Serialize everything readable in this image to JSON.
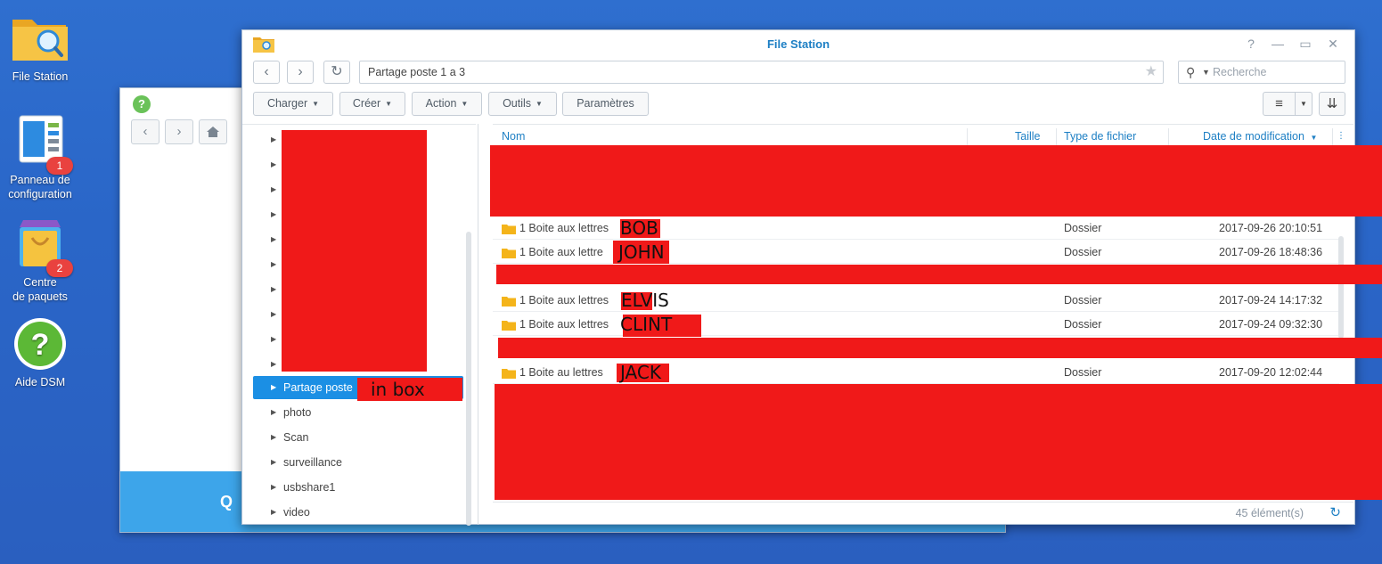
{
  "desktop": {
    "icons": [
      {
        "label": "File Station"
      },
      {
        "label": "Panneau de\nconfiguration",
        "badge": "1"
      },
      {
        "label": "Centre\nde paquets",
        "badge": "2"
      },
      {
        "label": "Aide DSM"
      }
    ]
  },
  "background_window": {
    "help_glyph": "?",
    "bottom_glyph": "Q"
  },
  "window": {
    "title": "File Station",
    "controls": {
      "help": "?",
      "minimize": "—",
      "maximize": "▭",
      "close": "✕"
    },
    "path": "Partage poste 1 a 3",
    "search_placeholder": "Recherche",
    "toolbar": {
      "upload": "Charger",
      "create": "Créer",
      "action": "Action",
      "tools": "Outils",
      "settings": "Paramètres"
    },
    "tree": {
      "selected": "Partage poste",
      "selected_overlay": "in box",
      "items": [
        "photo",
        "Scan",
        "surveillance",
        "usbshare1",
        "video"
      ]
    },
    "columns": {
      "name": "Nom",
      "size": "Taille",
      "type": "Type de fichier",
      "modified": "Date de modification"
    },
    "rows": [
      {
        "name": "1 Boite aux lettres",
        "label": "BOB",
        "type": "Dossier",
        "modified": "2017-09-26 20:10:51"
      },
      {
        "name": "1 Boite aux lettre",
        "label": "JOHN",
        "type": "Dossier",
        "modified": "2017-09-26 18:48:36"
      },
      {
        "name": "1 Boite aux lettres",
        "label": "ELVIS",
        "type": "Dossier",
        "modified": "2017-09-24 14:17:32"
      },
      {
        "name": "1 Boite aux lettres",
        "label": "CLINT",
        "type": "Dossier",
        "modified": "2017-09-24 09:32:30"
      },
      {
        "name": "1 Boite au lettres",
        "label": "JACK",
        "type": "Dossier",
        "modified": "2017-09-20 12:02:44"
      }
    ],
    "status": "45 élément(s)"
  },
  "colors": {
    "accent": "#1d7fc4",
    "selection": "#1b8fe4",
    "redaction": "#f01919",
    "desktop": "#2a66c8"
  }
}
